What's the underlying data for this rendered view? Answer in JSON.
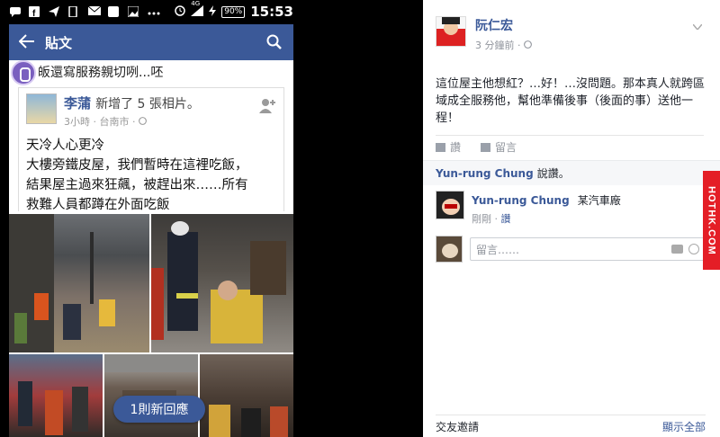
{
  "statusbar": {
    "network": "4G",
    "battery": "90%",
    "time": "15:53"
  },
  "appbar": {
    "title": "貼文"
  },
  "left_post": {
    "prev_comment": "皈還寫服務親切咧...呸",
    "author": "李蒲",
    "action": "新增了 5 張相片。",
    "meta": "3小時 · 台南市 · ",
    "text_lines": [
      "天冷人心更冷",
      "大樓旁鐵皮屋，我們暫時在這裡吃飯，",
      "結果屋主過來狂飆，被趕出來……所有",
      "救難人員都蹲在外面吃飯"
    ],
    "new_reply_button": "1則新回應"
  },
  "right_post": {
    "author": "阮仁宏",
    "meta": "3 分鐘前 · ",
    "text": "這位屋主他想紅？…好！…沒問題。那本真人就跨區域成全服務他，幫他準備後事（後面的事）送他一程！",
    "like_label": "讚",
    "comment_label": "留言",
    "likes_summary_name": "Yun-rung Chung",
    "likes_summary_suffix": "說讚。",
    "comment": {
      "name": "Yun-rung Chung",
      "text": "某汽車廠",
      "time": "剛剛",
      "sep": " · ",
      "like": "讚"
    },
    "reply_placeholder": "留言……",
    "footer_left": "交友邀請",
    "footer_right": "顯示全部"
  },
  "watermark": "HOTHK.COM",
  "colors": {
    "facebook_blue": "#3b5998",
    "watermark_red": "#e41e26"
  }
}
